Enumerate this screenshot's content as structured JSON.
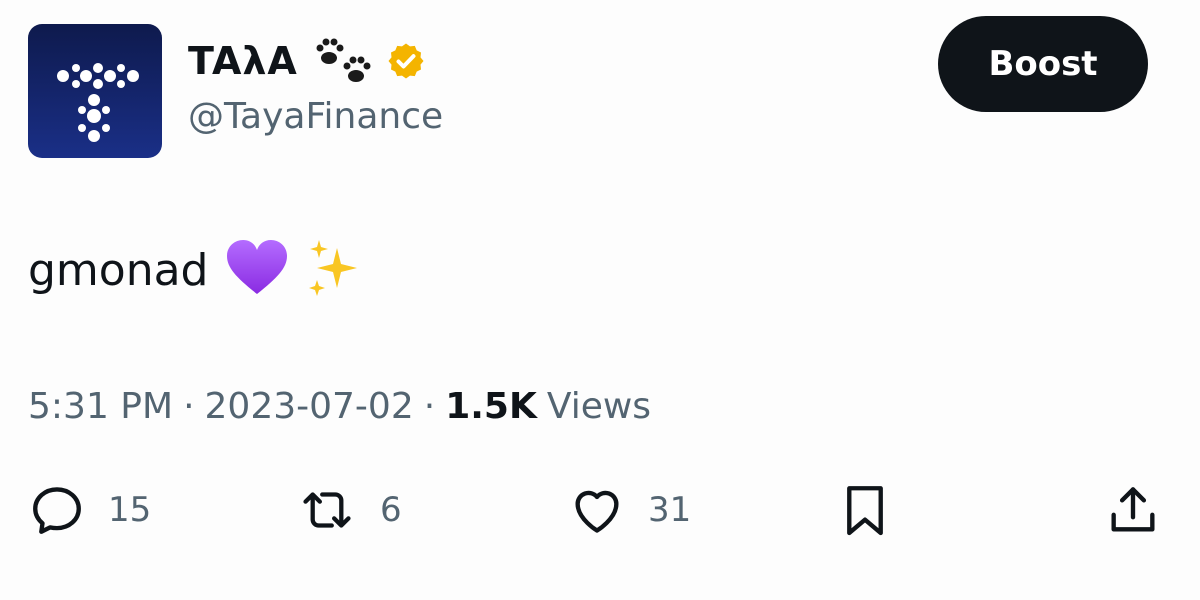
{
  "author": {
    "display_name": "TAλA",
    "handle": "@TayaFinance",
    "badge_icon": "paw-prints-icon",
    "verified_icon": "verified-gold-badge-icon",
    "verified_color": "#f4b400",
    "avatar_icon": "taya-logo-icon",
    "avatar_bg": "#13237a"
  },
  "boost_button": {
    "label": "Boost",
    "bg": "#0f1419",
    "color": "#ffffff"
  },
  "tweet": {
    "text": "gmonad",
    "emojis": [
      "purple-heart-icon",
      "sparkles-icon"
    ]
  },
  "meta": {
    "time": "5:31 PM",
    "separator": "·",
    "date": "2023-07-02",
    "views_count": "1.5K",
    "views_label": "Views"
  },
  "actions": {
    "reply": {
      "icon": "reply-icon",
      "count": "15"
    },
    "retweet": {
      "icon": "retweet-icon",
      "count": "6"
    },
    "like": {
      "icon": "like-heart-icon",
      "count": "31"
    },
    "bookmark": {
      "icon": "bookmark-icon"
    },
    "share": {
      "icon": "share-icon"
    }
  },
  "colors": {
    "text_primary": "#0f1419",
    "text_secondary": "#536471",
    "background": "#fdfdfd"
  }
}
